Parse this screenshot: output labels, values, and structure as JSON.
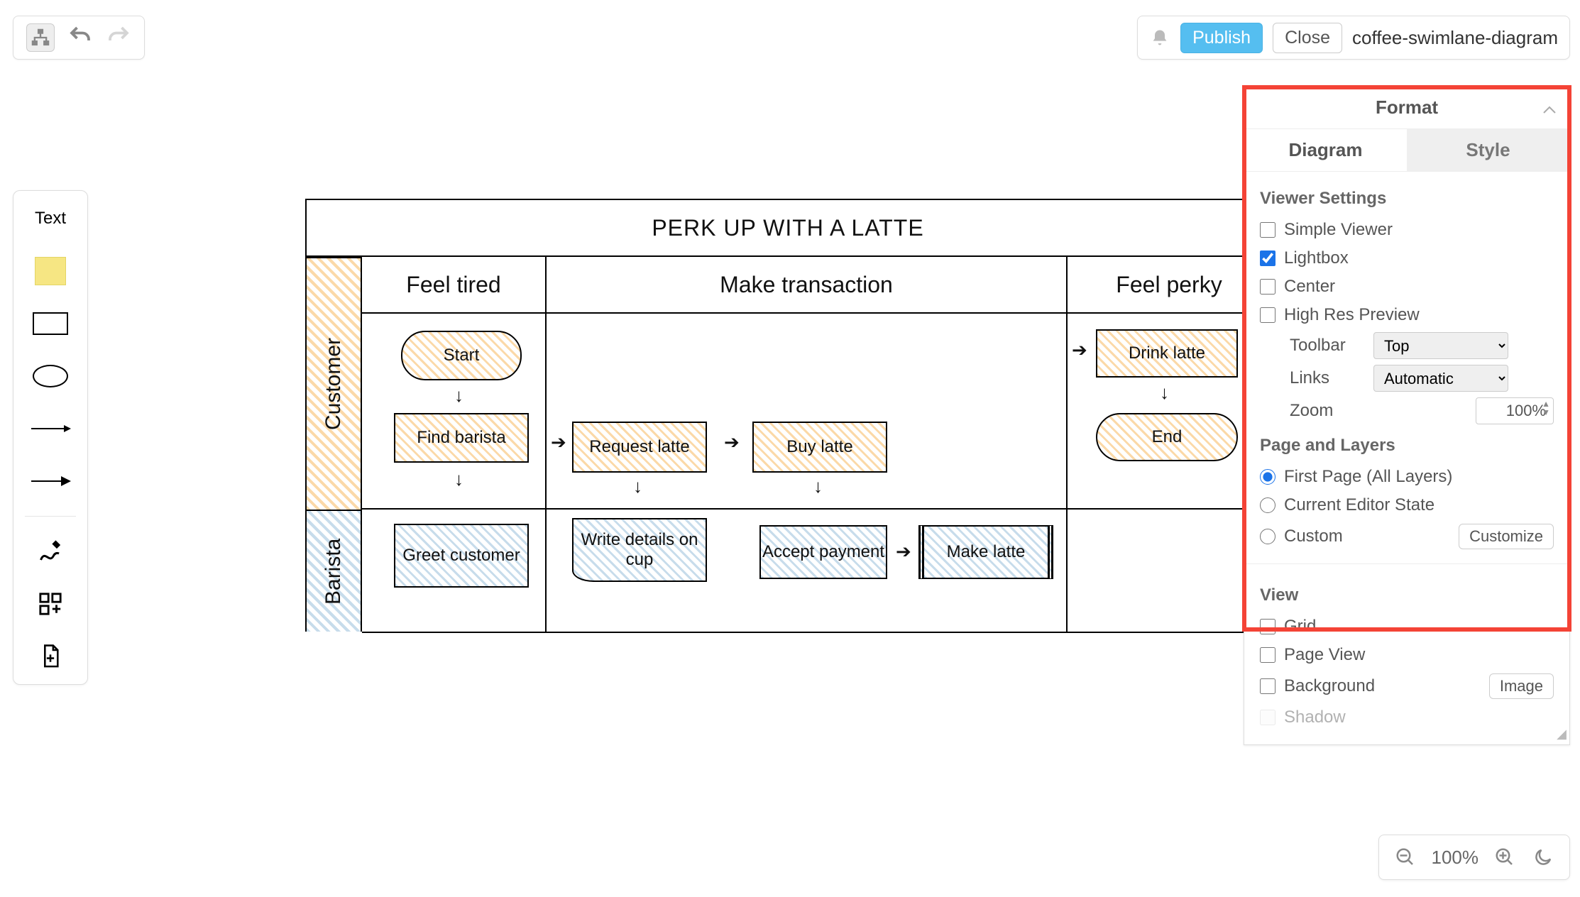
{
  "toolbar_top_right": {
    "publish_label": "Publish",
    "close_label": "Close",
    "diagram_name": "coffee-swimlane-diagram"
  },
  "palette": {
    "text_label": "Text"
  },
  "diagram": {
    "title": "PERK UP WITH A LATTE",
    "lanes": [
      {
        "id": "customer",
        "label": "Customer"
      },
      {
        "id": "barista",
        "label": "Barista"
      }
    ],
    "phases": [
      {
        "header": "Feel tired"
      },
      {
        "header": "Make transaction"
      },
      {
        "header": "Feel perky"
      }
    ],
    "nodes": {
      "start": "Start",
      "find_barista": "Find barista",
      "request_latte": "Request latte",
      "buy_latte": "Buy latte",
      "drink_latte": "Drink latte",
      "end": "End",
      "greet_customer": "Greet customer",
      "write_details": "Write details on cup",
      "accept_payment": "Accept payment",
      "make_latte": "Make latte"
    }
  },
  "format_panel": {
    "title": "Format",
    "tabs": {
      "diagram": "Diagram",
      "style": "Style"
    },
    "viewer_settings_title": "Viewer Settings",
    "viewer_settings": {
      "simple_viewer": "Simple Viewer",
      "lightbox": "Lightbox",
      "center": "Center",
      "high_res": "High Res Preview"
    },
    "toolbar_label": "Toolbar",
    "toolbar_value": "Top",
    "links_label": "Links",
    "links_value": "Automatic",
    "zoom_label": "Zoom",
    "zoom_value": "100%",
    "page_layers_title": "Page and Layers",
    "page_layers": {
      "first_page": "First Page (All Layers)",
      "current_state": "Current Editor State",
      "custom": "Custom",
      "customize_btn": "Customize"
    },
    "view_title": "View",
    "view": {
      "grid": "Grid",
      "page_view": "Page View",
      "background": "Background",
      "background_image_btn": "Image",
      "shadow": "Shadow"
    }
  },
  "zoom_bar": {
    "value": "100%"
  }
}
